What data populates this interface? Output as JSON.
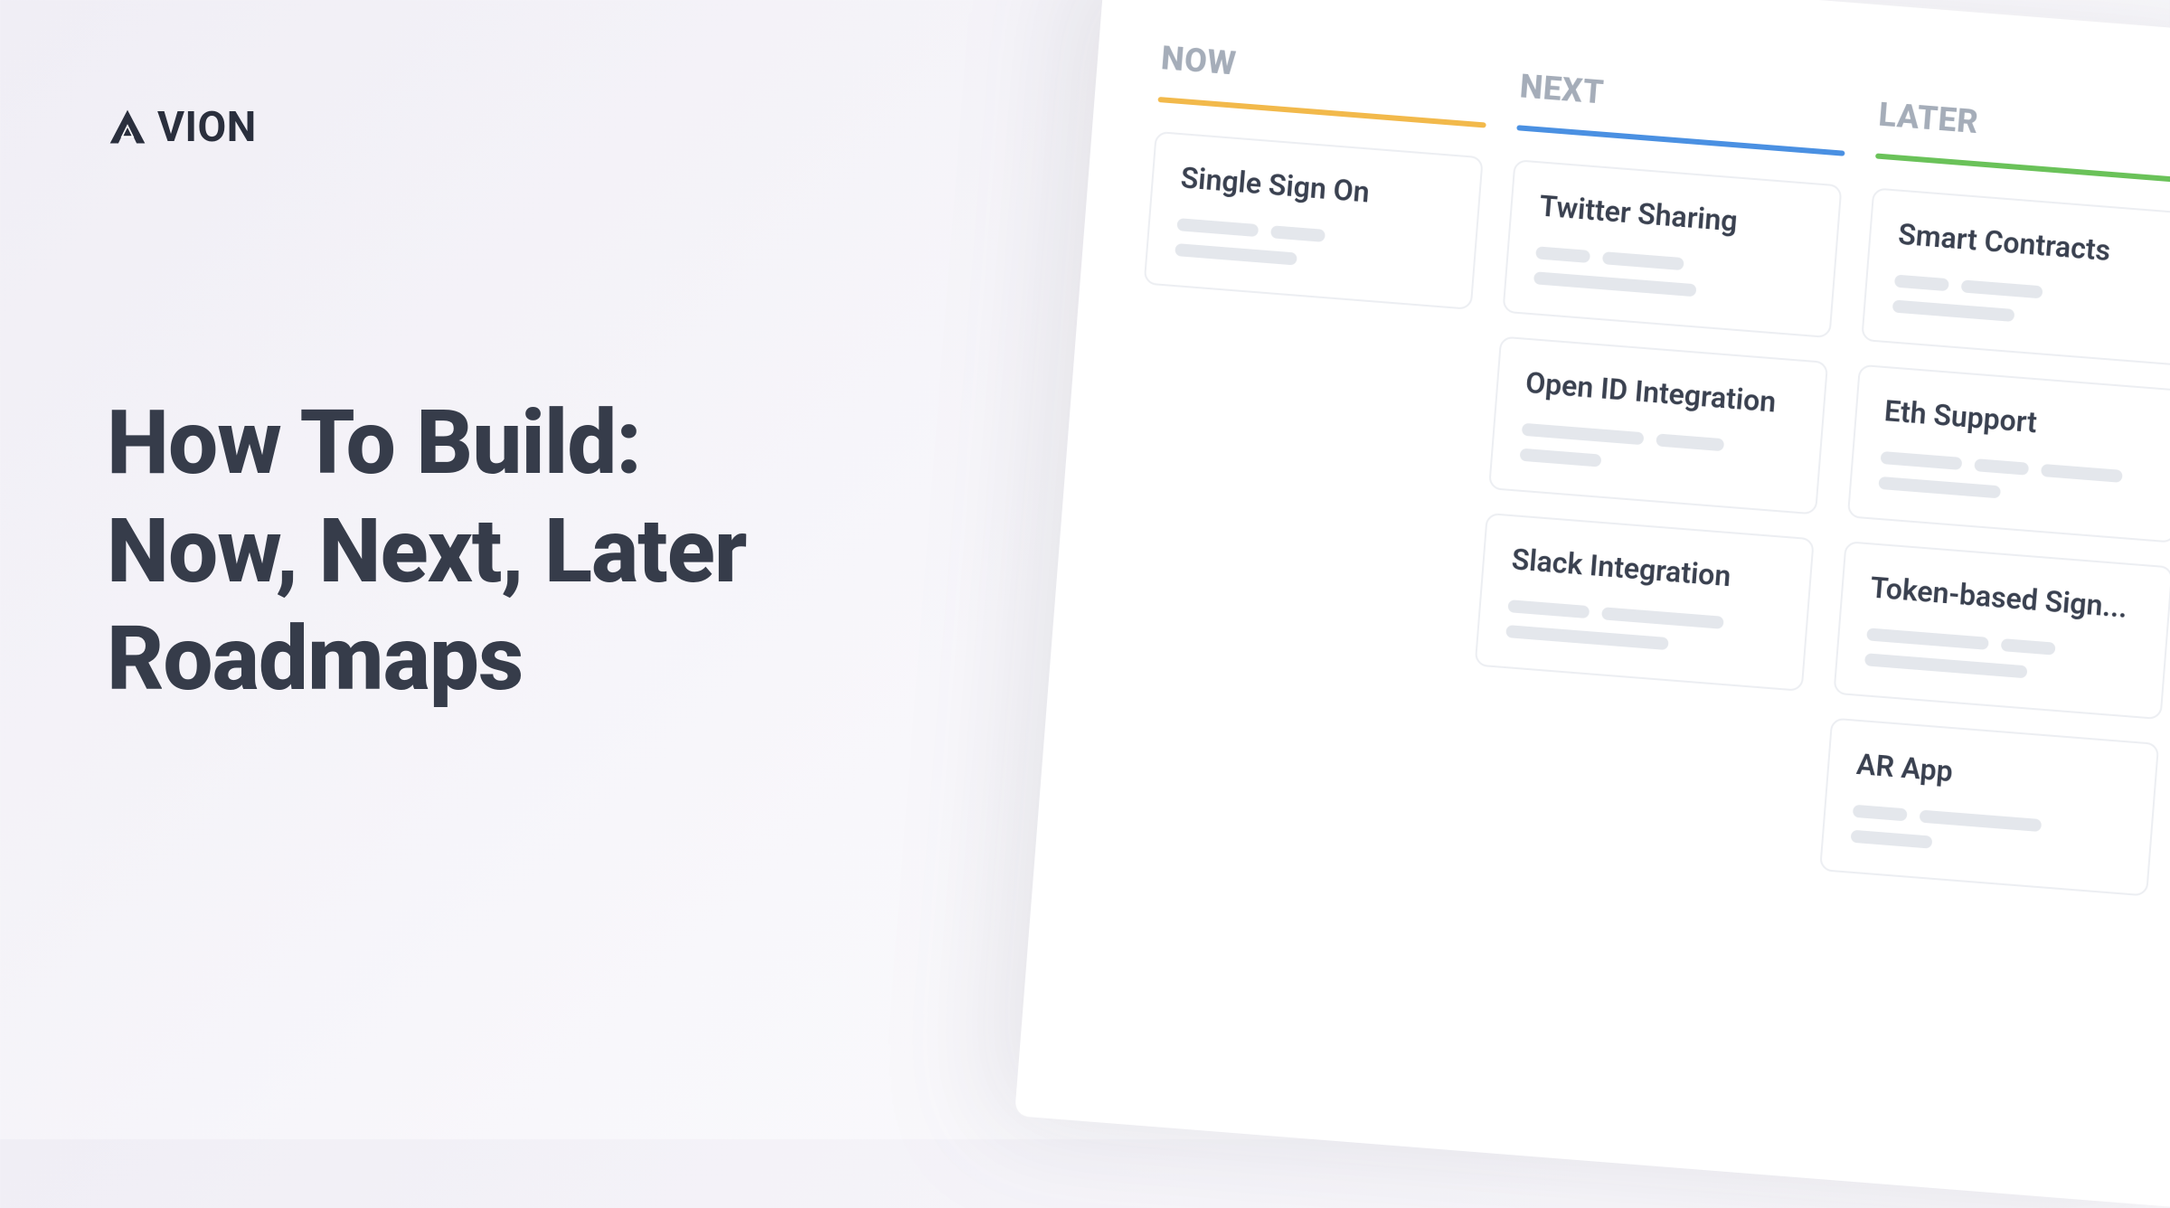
{
  "brand": {
    "name": "VION"
  },
  "title_line1": "How To Build:",
  "title_line2": "Now, Next, Later",
  "title_line3": "Roadmaps",
  "board": {
    "columns": [
      {
        "key": "now",
        "label": "NOW",
        "rule_color": "#f2b94b",
        "cards": [
          {
            "title": "Single Sign On"
          }
        ]
      },
      {
        "key": "next",
        "label": "NEXT",
        "rule_color": "#4a90e2",
        "cards": [
          {
            "title": "Twitter Sharing"
          },
          {
            "title": "Open ID Integration"
          },
          {
            "title": "Slack Integration"
          }
        ]
      },
      {
        "key": "later",
        "label": "LATER",
        "rule_color": "#6ac259",
        "cards": [
          {
            "title": "Smart Contracts"
          },
          {
            "title": "Eth Support"
          },
          {
            "title": "Token-based Sign..."
          },
          {
            "title": "AR App"
          }
        ]
      }
    ]
  }
}
